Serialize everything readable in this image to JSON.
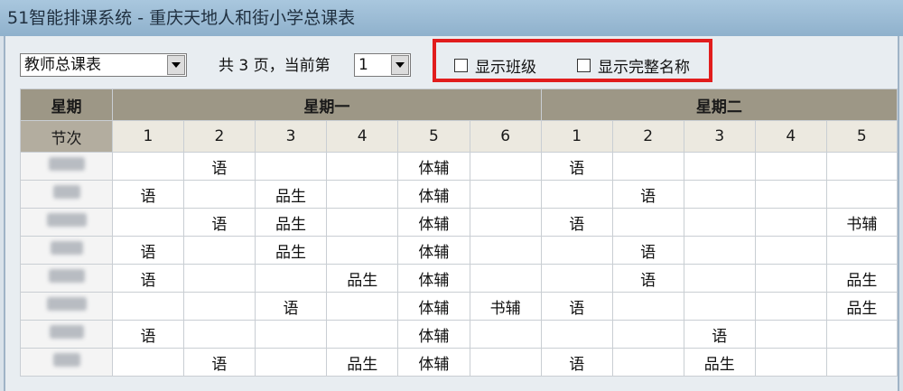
{
  "window": {
    "title": "51智能排课系统 - 重庆天地人和街小学总课表"
  },
  "toolbar": {
    "view_select": "教师总课表",
    "page_info": "共 3 页，当前第",
    "page_select": "1",
    "show_class_label": "显示班级",
    "show_fullname_label": "显示完整名称"
  },
  "schedule": {
    "header_day_label": "星期",
    "header_period_label": "节次",
    "days": [
      "星期一",
      "星期二"
    ],
    "periods": [
      "1",
      "2",
      "3",
      "4",
      "5",
      "6",
      "1",
      "2",
      "3",
      "4",
      "5"
    ],
    "rows": [
      [
        "",
        "语",
        "",
        "",
        "体辅",
        "",
        "语",
        "",
        "",
        "",
        ""
      ],
      [
        "语",
        "",
        "品生",
        "",
        "体辅",
        "",
        "",
        "语",
        "",
        "",
        ""
      ],
      [
        "",
        "语",
        "品生",
        "",
        "体辅",
        "",
        "语",
        "",
        "",
        "",
        "书辅"
      ],
      [
        "语",
        "",
        "品生",
        "",
        "体辅",
        "",
        "",
        "语",
        "",
        "",
        ""
      ],
      [
        "语",
        "",
        "",
        "品生",
        "体辅",
        "",
        "",
        "语",
        "",
        "",
        "品生"
      ],
      [
        "",
        "",
        "语",
        "",
        "体辅",
        "书辅",
        "语",
        "",
        "",
        "",
        "品生"
      ],
      [
        "语",
        "",
        "",
        "",
        "体辅",
        "",
        "",
        "",
        "语",
        "",
        ""
      ],
      [
        "",
        "语",
        "",
        "品生",
        "体辅",
        "",
        "语",
        "",
        "品生",
        "",
        ""
      ]
    ]
  }
}
